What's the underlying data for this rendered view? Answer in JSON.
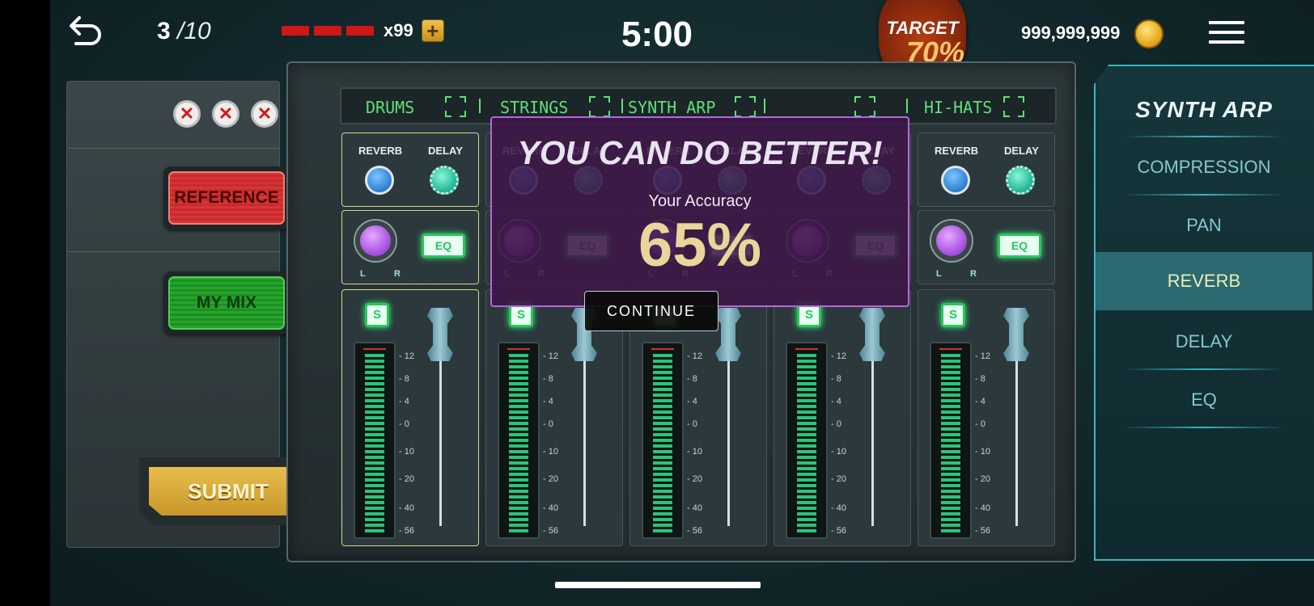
{
  "header": {
    "progress_current": "3",
    "progress_total": "/10",
    "lives_count": "x99",
    "timer": "5:00",
    "target_label": "TARGET",
    "target_value": "70%",
    "coins": "999,999,999"
  },
  "left_panel": {
    "strikes": [
      "✕",
      "✕",
      "✕"
    ],
    "reference_label": "REFERENCE",
    "mymix_label": "MY MIX",
    "submit_label": "SUBMIT"
  },
  "mixer": {
    "channels": [
      "DRUMS",
      "STRINGS",
      "SYNTH ARP",
      "",
      "HI-HATS"
    ],
    "selected_channel": 0,
    "fx_labels": {
      "reverb": "REVERB",
      "delay": "DELAY"
    },
    "pan_labels": {
      "left": "L",
      "right": "R"
    },
    "eq_label": "EQ",
    "solo_label": "S",
    "meter_scale": [
      "- 12",
      "- 8",
      "- 4",
      "- 0",
      "- 10",
      "- 20",
      "- 40",
      "- 56"
    ]
  },
  "right_panel": {
    "title": "SYNTH ARP",
    "items": [
      "COMPRESSION",
      "PAN",
      "REVERB",
      "DELAY",
      "EQ"
    ],
    "active_item": "REVERB"
  },
  "result_modal": {
    "title": "YOU CAN DO BETTER!",
    "accuracy_label": "Your Accuracy",
    "accuracy_value": "65%",
    "continue_label": "CONTINUE"
  },
  "colors": {
    "accent_green": "#5ee07a",
    "reference_red": "#d73636",
    "mymix_green": "#26a62c",
    "submit_gold": "#e7be4d",
    "panel_cyan": "#39b8bd",
    "modal_purple": "#3e1648"
  }
}
